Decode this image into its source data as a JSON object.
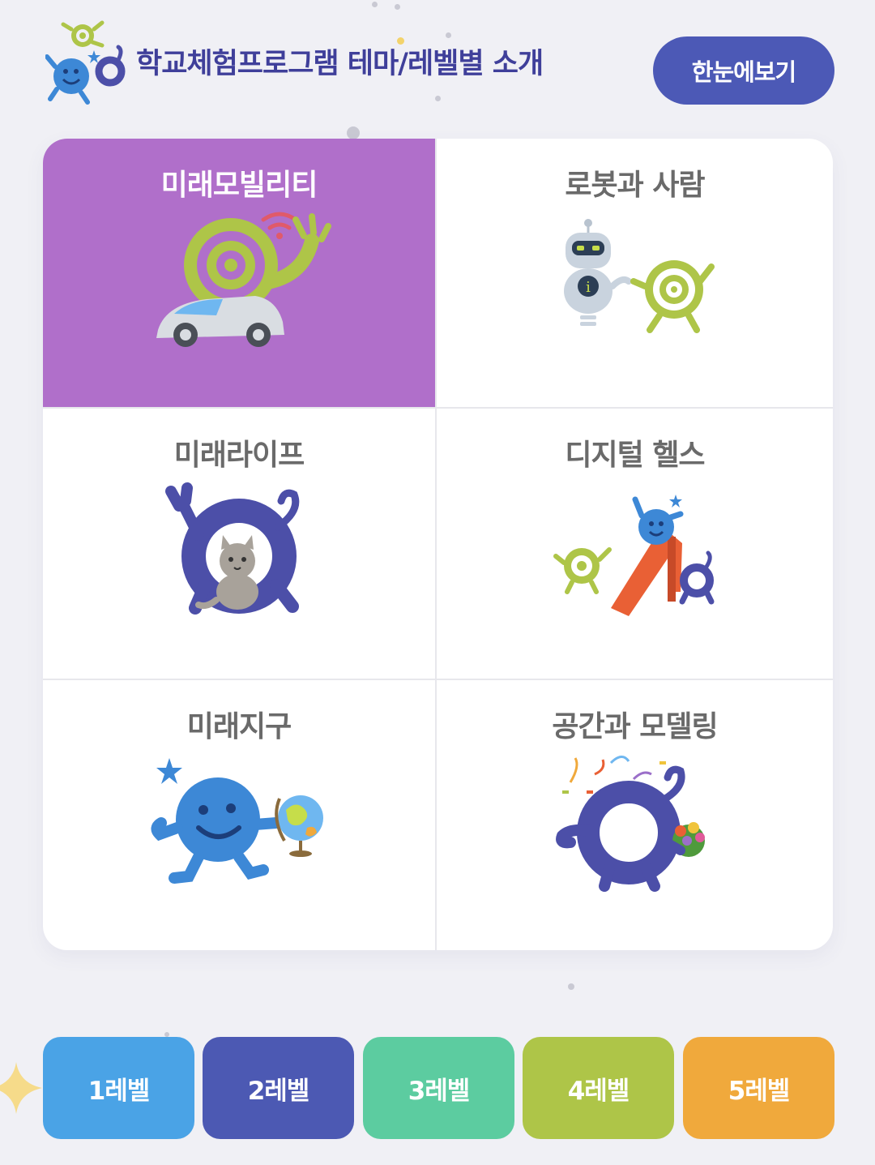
{
  "header": {
    "title": "학교체험프로그램 테마/레벨별 소개",
    "overview_button": "한눈에보기"
  },
  "themes": [
    {
      "label": "미래모빌리티",
      "icon": "green-swirl-car-icon",
      "selected": true
    },
    {
      "label": "로봇과 사람",
      "icon": "robot-and-swirl-icon",
      "selected": false
    },
    {
      "label": "미래라이프",
      "icon": "ring-character-with-cat-icon",
      "selected": false
    },
    {
      "label": "디지털 헬스",
      "icon": "characters-on-slide-icon",
      "selected": false
    },
    {
      "label": "미래지구",
      "icon": "blue-character-with-globe-icon",
      "selected": false
    },
    {
      "label": "공간과 모델링",
      "icon": "ring-character-with-confetti-icon",
      "selected": false
    }
  ],
  "levels": [
    {
      "label": "1레벨",
      "color": "#4aa3e6"
    },
    {
      "label": "2레벨",
      "color": "#4c59b3"
    },
    {
      "label": "3레벨",
      "color": "#5ccca0"
    },
    {
      "label": "4레벨",
      "color": "#aec548"
    },
    {
      "label": "5레벨",
      "color": "#f0a93c"
    }
  ],
  "colors": {
    "accent": "#4c59b6",
    "selected_theme": "#b06fca",
    "title": "#3f3f9a",
    "background": "#f0f0f5"
  }
}
